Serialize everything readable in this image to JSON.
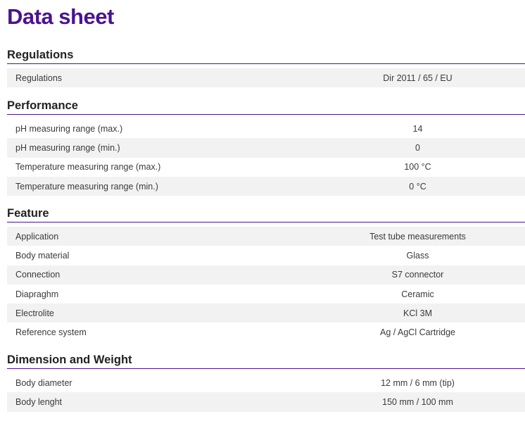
{
  "title": "Data sheet",
  "sections": [
    {
      "heading": "Regulations",
      "rows": [
        {
          "label": "Regulations",
          "value": "Dir 2011 / 65 / EU"
        }
      ]
    },
    {
      "heading": "Performance",
      "rows": [
        {
          "label": "pH measuring range (max.)",
          "value": "14"
        },
        {
          "label": "pH measuring range (min.)",
          "value": "0"
        },
        {
          "label": "Temperature measuring range (max.)",
          "value": "100 °C"
        },
        {
          "label": "Temperature measuring range (min.)",
          "value": "0 °C"
        }
      ]
    },
    {
      "heading": "Feature",
      "rows": [
        {
          "label": "Application",
          "value": "Test tube measurements"
        },
        {
          "label": "Body material",
          "value": "Glass"
        },
        {
          "label": "Connection",
          "value": "S7 connector"
        },
        {
          "label": "Diapraghm",
          "value": "Ceramic"
        },
        {
          "label": "Electrolite",
          "value": "KCl 3M"
        },
        {
          "label": "Reference system",
          "value": "Ag / AgCl Cartridge"
        }
      ]
    },
    {
      "heading": "Dimension and Weight",
      "rows": [
        {
          "label": "Body diameter",
          "value": "12 mm / 6 mm (tip)"
        },
        {
          "label": "Body lenght",
          "value": "150 mm / 100 mm"
        }
      ]
    }
  ],
  "colors": {
    "accent": "#4a1390",
    "row_shade": "#f2f2f2"
  }
}
